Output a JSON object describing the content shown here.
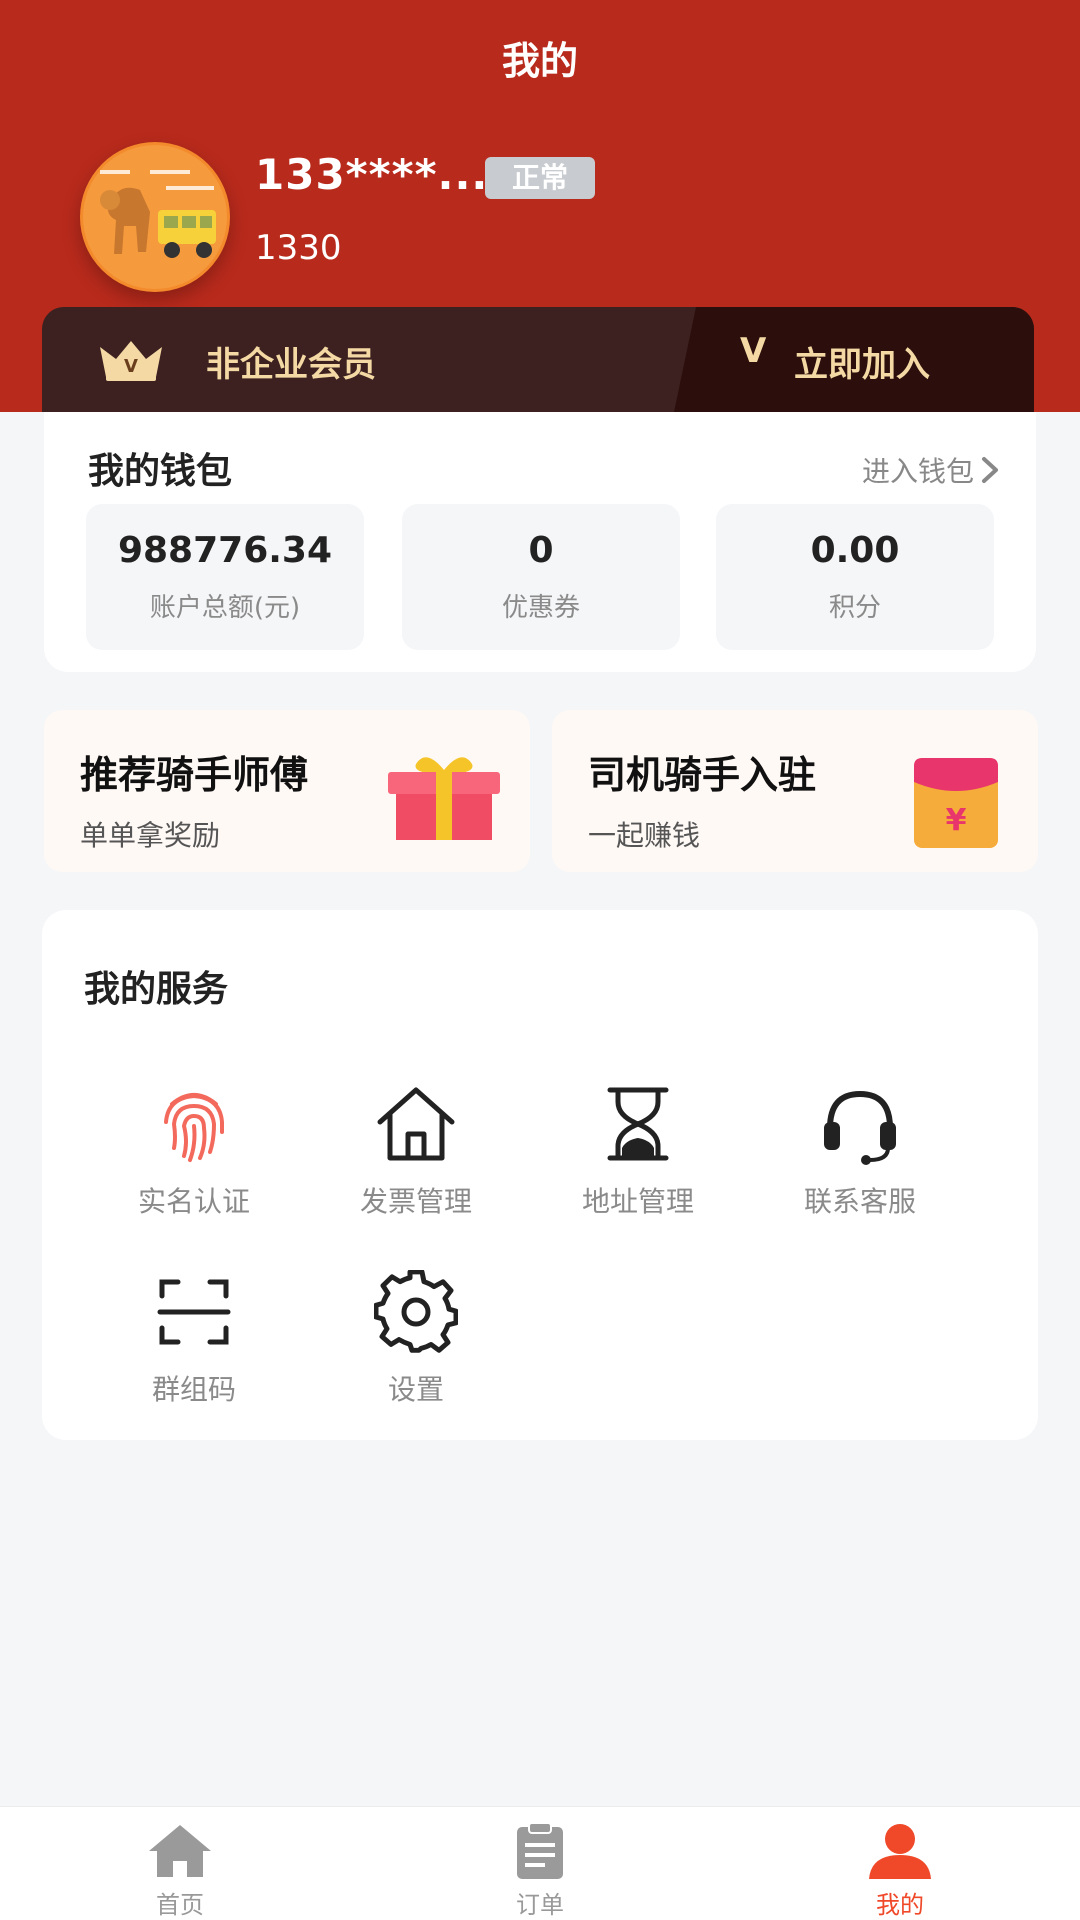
{
  "header": {
    "title": "我的"
  },
  "user": {
    "name": "133****...",
    "status": "正常",
    "id": "1330"
  },
  "membership": {
    "label": "非企业会员",
    "v_mark": "V",
    "join_label": "立即加入"
  },
  "wallet": {
    "title": "我的钱包",
    "link": "进入钱包",
    "stats": [
      {
        "value": "988776.34",
        "label": "账户总额(元)"
      },
      {
        "value": "0",
        "label": "优惠券"
      },
      {
        "value": "0.00",
        "label": "积分"
      }
    ]
  },
  "promos": [
    {
      "title": "推荐骑手师傅",
      "subtitle": "单单拿奖励",
      "icon": "gift-icon"
    },
    {
      "title": "司机骑手入驻",
      "subtitle": "一起赚钱",
      "icon": "red-envelope-icon"
    }
  ],
  "services": {
    "title": "我的服务",
    "items": [
      {
        "label": "实名认证",
        "icon": "fingerprint-icon"
      },
      {
        "label": "发票管理",
        "icon": "home-icon"
      },
      {
        "label": "地址管理",
        "icon": "hourglass-icon"
      },
      {
        "label": "联系客服",
        "icon": "headset-icon"
      },
      {
        "label": "群组码",
        "icon": "scan-icon"
      },
      {
        "label": "设置",
        "icon": "gear-icon"
      }
    ]
  },
  "tabbar": {
    "items": [
      {
        "label": "首页",
        "icon": "home-icon"
      },
      {
        "label": "订单",
        "icon": "clipboard-icon"
      },
      {
        "label": "我的",
        "icon": "user-icon",
        "active": true
      }
    ]
  },
  "colors": {
    "header_bg": "#b82a1c",
    "member_bar": "#3c2120",
    "member_gold": "#f4d9a4",
    "accent": "#f0492a"
  }
}
